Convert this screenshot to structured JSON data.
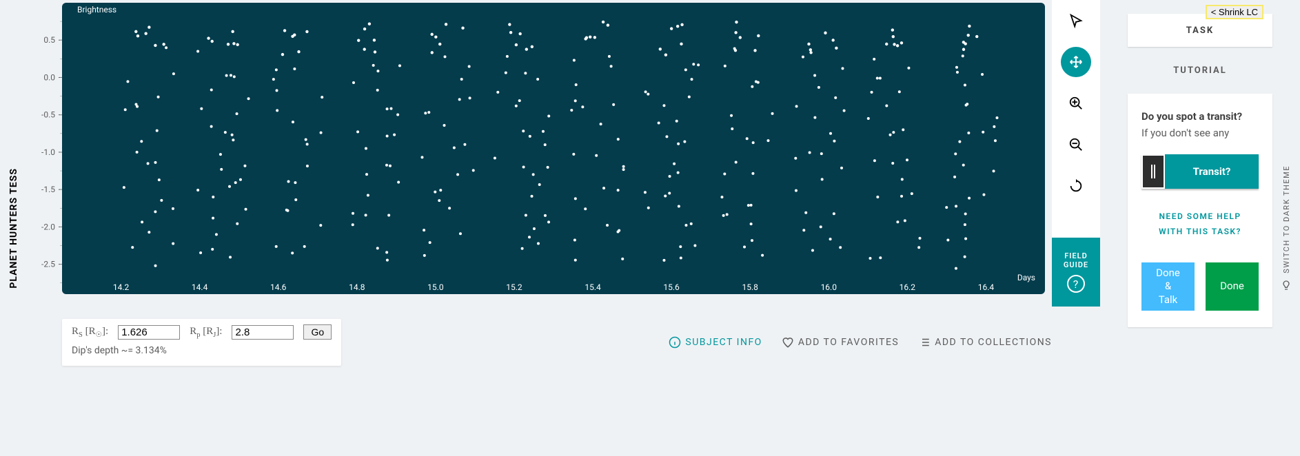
{
  "project_title": "PLANET HUNTERS TESS",
  "shrink_button": "< Shrink LC",
  "chart_data": {
    "type": "scatter",
    "title": "",
    "xlabel": "Days",
    "ylabel": "Brightness",
    "x_ticks": [
      14.2,
      14.4,
      14.6,
      14.8,
      15.0,
      15.2,
      15.4,
      15.6,
      15.8,
      16.0,
      16.2,
      16.4
    ],
    "y_ticks": [
      0.5,
      0.0,
      -0.5,
      -1.0,
      -1.5,
      -2.0,
      -2.5
    ],
    "xlim": [
      14.05,
      16.55
    ],
    "ylim": [
      -2.9,
      1.0
    ],
    "series": [
      {
        "name": "Brightness",
        "note": "Periodic light-curve scatter; approx. 12 repeating groups between x≈14.25 and x≈16.45. Within each group points span roughly y=0.7 down to y≈-2.6.",
        "x": [],
        "y": []
      }
    ]
  },
  "toolbar": {
    "pointer": "pointer",
    "move": "move",
    "zoom_in": "zoom-in",
    "zoom_out": "zoom-out",
    "reset": "reset"
  },
  "field_guide": {
    "line1": "FIELD",
    "line2": "GUIDE"
  },
  "calc": {
    "rs_label_html": "R<sub>S</sub> [R<sub>☉</sub>]:",
    "rs_label": "R_S [R_sun]:",
    "rs_value": "1.626",
    "rp_label_html": "R<sub>p</sub> [R<sub>J</sub>]:",
    "rp_label": "R_p [R_J]:",
    "rp_value": "2.8",
    "go": "Go",
    "dip": "Dip's depth ~= 3.134%"
  },
  "meta": {
    "subject_info": "SUBJECT INFO",
    "favorites": "ADD TO FAVORITES",
    "collections": "ADD TO COLLECTIONS"
  },
  "task_panel": {
    "task_tab": "TASK",
    "tutorial_tab": "TUTORIAL",
    "question": "Do you spot a transit?",
    "subtitle": "If you don't see any",
    "transit_button": "Transit?",
    "help_line1": "NEED SOME HELP",
    "help_line2": "WITH THIS TASK?",
    "done_talk": "Done & Talk",
    "done": "Done"
  },
  "theme_switch": "SWITCH TO DARK THEME"
}
